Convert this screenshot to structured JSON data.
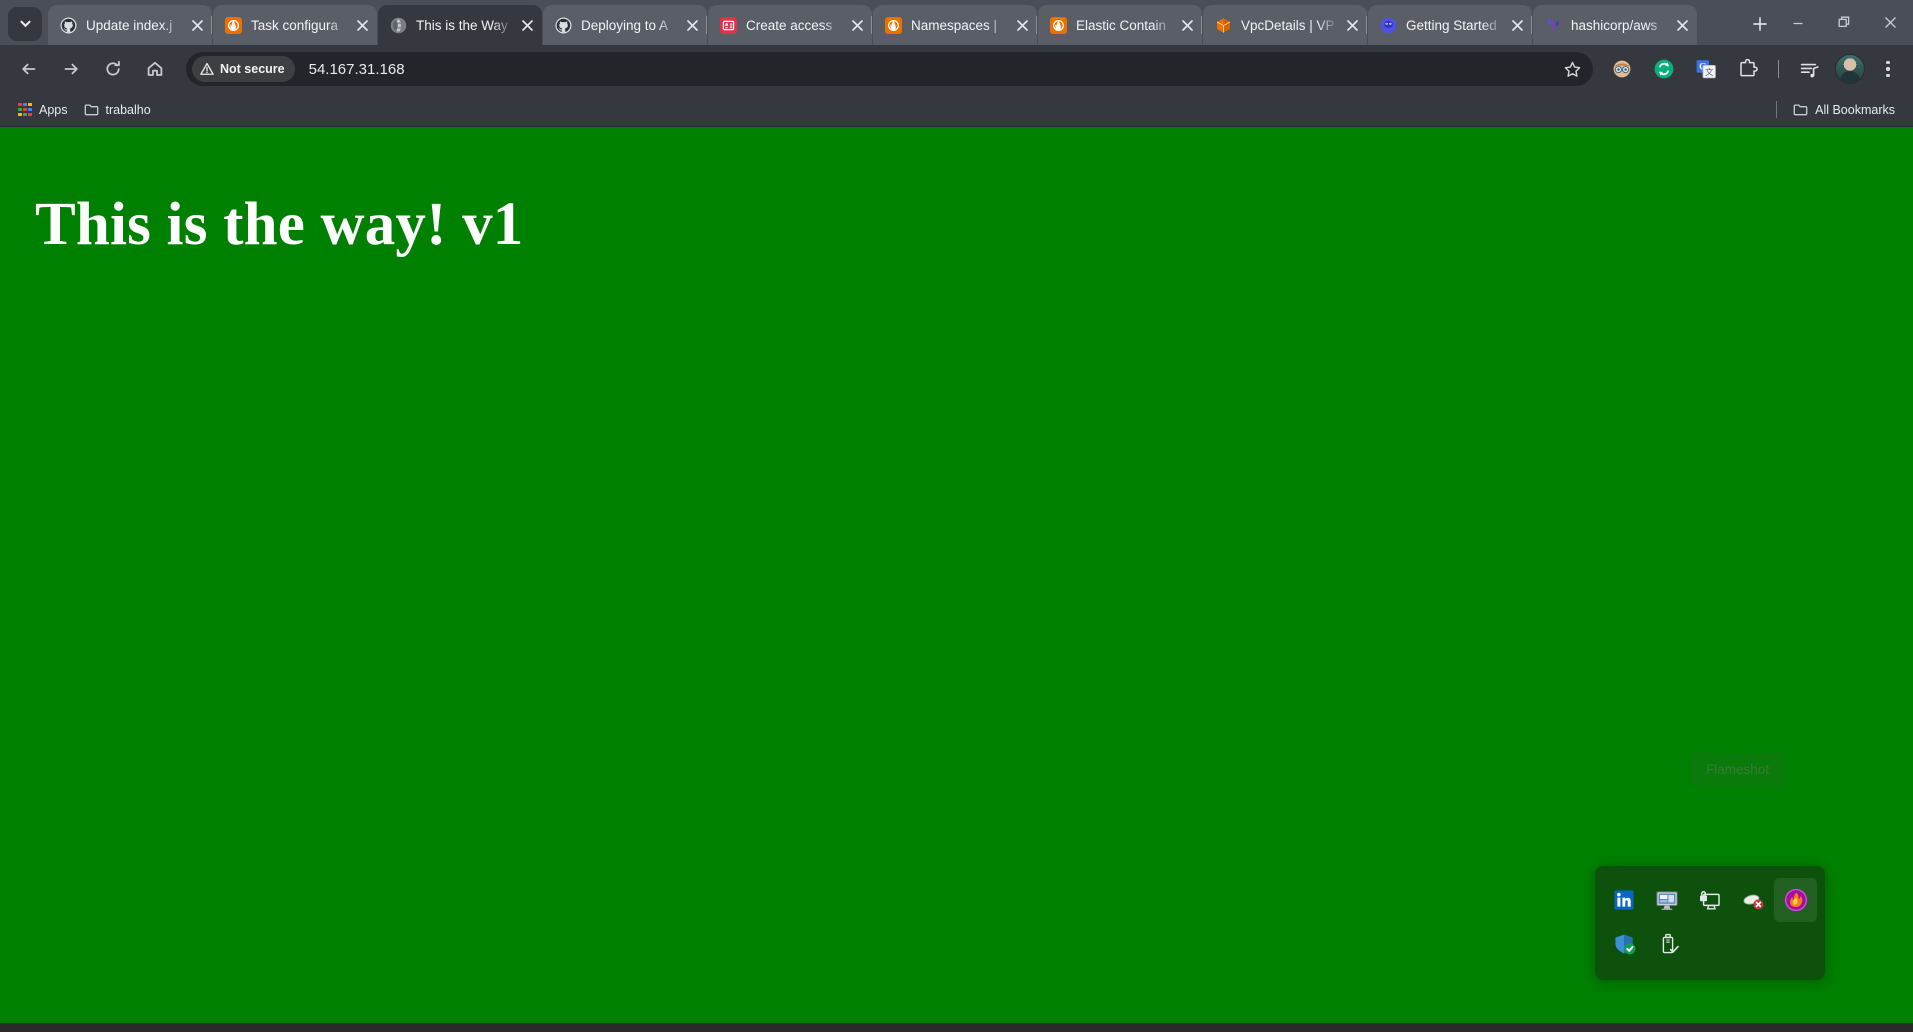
{
  "window": {
    "controls": [
      {
        "name": "minimize",
        "label": "—"
      },
      {
        "name": "restore",
        "label": "❐"
      },
      {
        "name": "close",
        "label": "✕"
      }
    ]
  },
  "tabstrip": {
    "tab_search_label": "Search tabs",
    "new_tab_label": "New tab",
    "tabs": [
      {
        "title": "Update index.j",
        "favicon": "github-icon",
        "active": false
      },
      {
        "title": "Task configura",
        "favicon": "aws-ecs-icon",
        "active": false
      },
      {
        "title": "This is the Way",
        "favicon": "globe-icon",
        "active": true
      },
      {
        "title": "Deploying to A",
        "favicon": "github-icon",
        "active": false
      },
      {
        "title": "Create access ",
        "favicon": "aws-iam-icon",
        "active": false
      },
      {
        "title": "Namespaces | ",
        "favicon": "aws-ecs-icon",
        "active": false
      },
      {
        "title": "Elastic Contain",
        "favicon": "aws-ecs-icon",
        "active": false
      },
      {
        "title": "VpcDetails | VP",
        "favicon": "aws-vpc-icon",
        "active": false
      },
      {
        "title": "Getting Started",
        "favicon": "docker-icon",
        "active": false
      },
      {
        "title": "hashicorp/aws",
        "favicon": "terraform-icon",
        "active": false
      }
    ]
  },
  "toolbar": {
    "back_label": "Back",
    "forward_label": "Forward",
    "reload_label": "Reload",
    "home_label": "Home",
    "security_badge": "Not secure",
    "url": "54.167.31.168",
    "bookmark_label": "Bookmark this tab",
    "extensions": [
      {
        "name": "face-extension-icon"
      },
      {
        "name": "sync-extension-icon"
      },
      {
        "name": "google-translate-icon"
      },
      {
        "name": "extensions-puzzle-icon"
      }
    ],
    "media_label": "Media controls",
    "profile_label": "Profile",
    "menu_label": "Customize and control Google Chrome"
  },
  "bookmarks_bar": {
    "items": [
      {
        "label": "Apps",
        "icon": "apps-grid-icon"
      },
      {
        "label": "trabalho",
        "icon": "folder-icon"
      }
    ],
    "all_bookmarks": {
      "label": "All Bookmarks",
      "icon": "folder-icon"
    }
  },
  "page": {
    "heading": "This is the way! v1",
    "background_color": "#008000",
    "text_color": "#ffffff"
  },
  "tray": {
    "tooltip": "Flameshot",
    "row1": [
      {
        "name": "linkedin-icon",
        "label": "LinkedIn"
      },
      {
        "name": "display-settings-icon",
        "label": "Display"
      },
      {
        "name": "lock-screen-icon",
        "label": "Lock screen"
      },
      {
        "name": "network-disconnected-icon",
        "label": "Network disconnected"
      },
      {
        "name": "flameshot-icon",
        "label": "Flameshot",
        "selected": true
      }
    ],
    "row2": [
      {
        "name": "windows-security-icon",
        "label": "Windows Security"
      },
      {
        "name": "safely-remove-hardware-icon",
        "label": "Safely Remove Hardware"
      }
    ]
  },
  "colors": {
    "tabstrip_bg": "#4a4e57",
    "toolbar_bg": "#35383e",
    "tab_inactive": "#5a5e67",
    "tab_active": "#35383e",
    "page_green": "#008000",
    "tray_panel": "#0e4e0e"
  }
}
